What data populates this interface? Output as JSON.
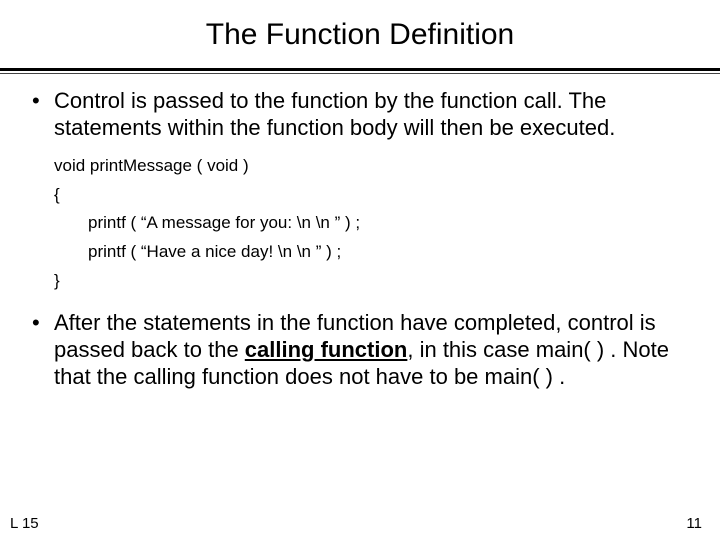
{
  "title": "The Function Definition",
  "bullet1": "Control is passed to the function by the function call.  The statements within the function body will then be executed.",
  "code": {
    "sig": "void printMessage ( void )",
    "open": "{",
    "line1": "printf ( “A message for you: \\n \\n ” ) ;",
    "line2": "printf ( “Have a nice day! \\n \\n ” ) ;",
    "close": "}"
  },
  "bullet2_pre": "After the statements in the function have completed, control is passed back to the ",
  "bullet2_bold": "calling function",
  "bullet2_post": ", in this case main( ) .  Note that the calling function does not have to be main( ) .",
  "footer_left": "L 15",
  "footer_right": "11"
}
